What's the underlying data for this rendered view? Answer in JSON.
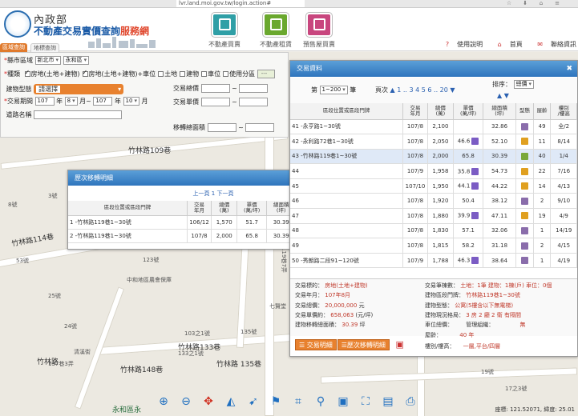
{
  "browser": {
    "url": "lvr.land.moi.gov.tw/login.action#"
  },
  "header": {
    "agency": "內政部",
    "site_title_main": "不動產交易實價查詢",
    "site_title_accent": "服務網",
    "nav": [
      {
        "label": "不動產買賣",
        "color": "#2f9fa6"
      },
      {
        "label": "不動產租賃",
        "color": "#6aa82e"
      },
      {
        "label": "預售屋買賣",
        "color": "#c8467e"
      }
    ],
    "links": {
      "help": "使用說明",
      "home": "首頁",
      "contact": "聯絡資訊"
    }
  },
  "tabs": {
    "area_query": "區域查詢",
    "map_query": "地標查詢"
  },
  "search": {
    "county_label": "縣市區域",
    "county": "新北市",
    "district": "永和區",
    "type_label": "種類",
    "type_options": [
      {
        "label": "房地(土地+建物)",
        "checked": true
      },
      {
        "label": "房地(土地+建物)+車位",
        "checked": true
      },
      {
        "label": "土地",
        "checked": false
      },
      {
        "label": "建物",
        "checked": false
      },
      {
        "label": "車位",
        "checked": false
      },
      {
        "label": "使用分區",
        "checked": false
      }
    ],
    "building_type_label": "建物型態",
    "building_type_value": "請選擇",
    "period_label": "交易期間",
    "from_year": "107",
    "from_month": "8",
    "to_year": "107",
    "to_month": "10",
    "unit_month": "月~",
    "unit_month_end": "月",
    "address_label": "道路名稱",
    "total_price_label": "交易總價",
    "unit_price_label": "交易單價",
    "area_label": "移轉總面積"
  },
  "history_window": {
    "title": "歷次移轉明細",
    "pager": "上一頁 1 下一頁",
    "columns": [
      "區段位置或區段門牌",
      "交易\n年月",
      "總價\n(萬)",
      "單價\n(萬/坪)",
      "總面積\n(坪)",
      "型態",
      "屋齡",
      "樓別\n/樓高"
    ],
    "rows": [
      {
        "addr": "1 -竹林路119巷1~30號",
        "ym": "106/12",
        "total": "1,570",
        "unit": "51.7",
        "area": "30.39",
        "age": "40",
        "floor": "1/4"
      },
      {
        "addr": "2 -竹林路119巷1~30號",
        "ym": "107/8",
        "total": "2,000",
        "unit": "65.8",
        "area": "30.39",
        "age": "40",
        "floor": "1/4"
      }
    ]
  },
  "tx_window": {
    "title": "交易資料",
    "page_label": "第",
    "page_select": "1~200",
    "page_suffix": "筆",
    "pages_label": "頁次",
    "pages": "▲ 1 .. 3 4 5 6 .. 20 ▼",
    "sort_label": "排序：",
    "sort_value": "總價",
    "columns": [
      "區段位置或區段門牌",
      "交易\n年月",
      "總價\n(萬)",
      "單價\n(萬/坪)",
      "總面積\n(坪)",
      "型態",
      "屋齡",
      "樓別\n/樓高"
    ],
    "rows": [
      {
        "addr": "41 -永亨路1~30號",
        "ym": "107/8",
        "total": "2,100",
        "unit": "",
        "area": "32.86",
        "age": "49",
        "floor": "全/2",
        "badge": false,
        "type_color": "#8a6dab"
      },
      {
        "addr": "42 -永利路72巷1~30號",
        "ym": "107/8",
        "total": "2,050",
        "unit": "46.6",
        "area": "52.10",
        "age": "11",
        "floor": "8/14",
        "badge": true,
        "type_color": "#e0a020"
      },
      {
        "addr": "43 -竹林路119巷1~30號",
        "ym": "107/8",
        "total": "2,000",
        "unit": "65.8",
        "area": "30.39",
        "age": "40",
        "floor": "1/4",
        "badge": false,
        "type_color": "#7aa83a"
      },
      {
        "addr": "44",
        "ym": "107/9",
        "total": "1,958",
        "unit": "35.8",
        "area": "54.73",
        "age": "22",
        "floor": "7/16",
        "badge": true,
        "type_color": "#e0a020"
      },
      {
        "addr": "45",
        "ym": "107/10",
        "total": "1,950",
        "unit": "44.1",
        "area": "44.22",
        "age": "14",
        "floor": "4/13",
        "badge": true,
        "type_color": "#e0a020"
      },
      {
        "addr": "46",
        "ym": "107/8",
        "total": "1,920",
        "unit": "50.4",
        "area": "38.12",
        "age": "2",
        "floor": "9/10",
        "badge": false,
        "type_color": "#8a6dab"
      },
      {
        "addr": "47",
        "ym": "107/8",
        "total": "1,880",
        "unit": "39.9",
        "area": "47.11",
        "age": "19",
        "floor": "4/9",
        "badge": true,
        "type_color": "#e0a020"
      },
      {
        "addr": "48",
        "ym": "107/8",
        "total": "1,830",
        "unit": "57.1",
        "area": "32.06",
        "age": "1",
        "floor": "14/19",
        "badge": false,
        "type_color": "#8a6dab"
      },
      {
        "addr": "49",
        "ym": "107/8",
        "total": "1,815",
        "unit": "58.2",
        "area": "31.18",
        "age": "2",
        "floor": "4/15",
        "badge": false,
        "type_color": "#8a6dab"
      },
      {
        "addr": "50 -秀朗路二段91~120號",
        "ym": "107/9",
        "total": "1,788",
        "unit": "46.3",
        "area": "38.64",
        "age": "1",
        "floor": "4/19",
        "badge": true,
        "type_color": "#8a6dab"
      }
    ],
    "detail": {
      "k1": "交易標的：",
      "v1": "房地(土地+建物)",
      "k2": "交易年月：",
      "v2": "107年8月",
      "k3": "交易總價：",
      "v3": "20,000,000",
      "u3": "元",
      "k4": "交易單價約：",
      "v4": "658,063",
      "u4": "(元/坪)",
      "k5": "建物移轉總面積：",
      "v5": "30.39",
      "u5": "坪",
      "k6": "交易筆棟數：",
      "v6": "土地：1筆 建物：1棟(戶) 車位：0個",
      "k7": "建物區段門牌：",
      "v7": "竹林路119巷1~30號",
      "k8": "建物型態：",
      "v8": "公寓(5樓含以下無電梯)",
      "k9": "建物現況格局：",
      "v9": "3 房 2 廳 2 衛 有隔間",
      "k10": "車位總價：",
      "v10": "無",
      "k10b": "管理組織：",
      "k11": "屋齡：",
      "v11": "40 年",
      "k12": "樓別/樓高：",
      "v12": "一層,平台/四層"
    },
    "btn_detail": "交易明細",
    "btn_history": "歷次移轉明細"
  },
  "map": {
    "labels": {
      "l1": "竹林路109巷",
      "l2": "竹林路114巷",
      "l3": "竹林路133巷",
      "l4": "竹林路148巷",
      "l5": "竹林路 135巷",
      "l6": "竹林路",
      "l7": "永和區永",
      "l8": "119巷7弄",
      "l9": "中和地區農會保庫",
      "l10": "清溪街",
      "l11": "137巷3弄",
      "l12": "七賢堂",
      "l13": "103之1號",
      "l14": "133之1號",
      "l15": "135號",
      "l16": "8號",
      "l17": "53號",
      "l18": "25號",
      "l19": "123號",
      "l20": "9號",
      "l21": "3號",
      "l22": "24號",
      "l23": "19號",
      "l24": "17之3號"
    },
    "coords": "座標: 121.52071, 緯度: 25.01"
  }
}
